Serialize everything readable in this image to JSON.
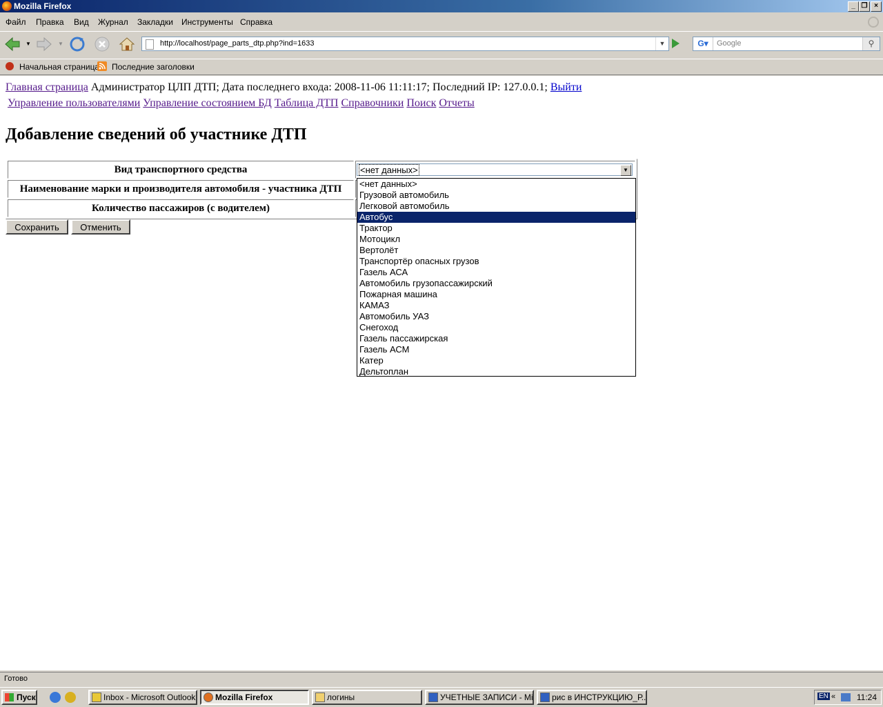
{
  "window": {
    "title": "Mozilla Firefox"
  },
  "menu": [
    "Файл",
    "Правка",
    "Вид",
    "Журнал",
    "Закладки",
    "Инструменты",
    "Справка"
  ],
  "url": "http://localhost/page_parts_dtp.php?ind=1633",
  "search_placeholder": "Google",
  "bookmarks": [
    "Начальная страница",
    "Последние заголовки"
  ],
  "header": {
    "home_link": "Главная страница",
    "info": " Администратор ЦЛП ДТП; Дата последнего входа: 2008-11-06 11:11:17; Последний IP: 127.0.0.1; ",
    "logout_link": "Выйти"
  },
  "nav_links": [
    "Управление пользователями",
    "Управление состоянием БД",
    "Таблица ДТП",
    "Справочники",
    "Поиск",
    "Отчеты"
  ],
  "page_title": "Добавление сведений об участнике ДТП",
  "form": {
    "rows": [
      "Вид транспортного средства",
      "Наименование марки и производителя автомобиля - участника ДТП",
      "Количество пассажиров (с водителем)"
    ],
    "select_value": "<нет данных>",
    "save_label": "Сохранить",
    "cancel_label": "Отменить"
  },
  "dropdown": {
    "selected_index": 3,
    "options": [
      "<нет данных>",
      "Грузовой автомобиль",
      "Легковой автомобиль",
      "Автобус",
      "Трактор",
      "Мотоцикл",
      "Вертолёт",
      "Транспортёр опасных грузов",
      "Газель АСА",
      "Автомобиль грузопассажирский",
      "Пожарная машина",
      "КАМАЗ",
      "Автомобиль УАЗ",
      "Снегоход",
      "Газель пассажирская",
      "Газель АСМ",
      "Катер",
      "Дельтоплан"
    ]
  },
  "status": "Готово",
  "taskbar": {
    "start": "Пуск",
    "tasks": [
      "Inbox - Microsoft Outlook",
      "Mozilla Firefox",
      "логины",
      "УЧЕТНЫЕ ЗАПИСИ - Mi...",
      "рис в ИНСТРУКЦИЮ_Р..."
    ],
    "lang": "EN",
    "clock": "11:24"
  }
}
